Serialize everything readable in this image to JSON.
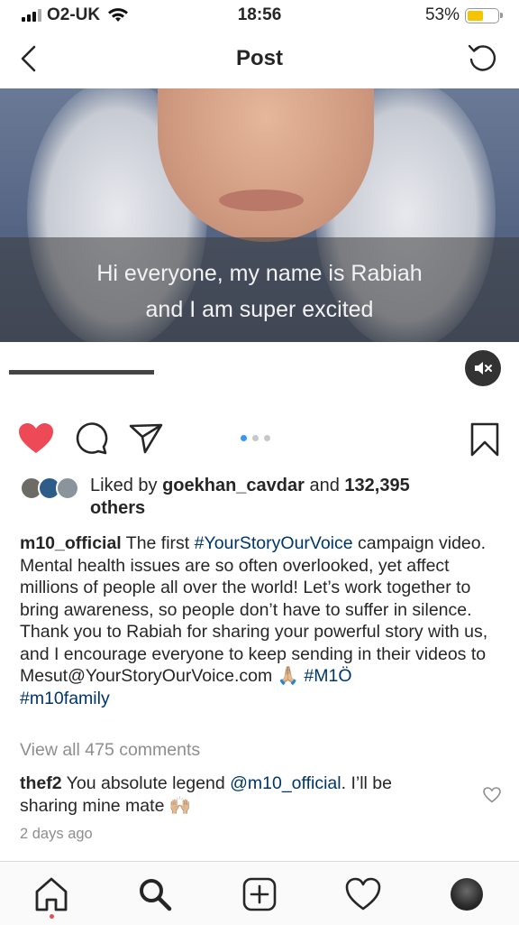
{
  "status_bar": {
    "carrier": "O2-UK",
    "time": "18:56",
    "battery_percent": "53%",
    "battery_level": 0.53
  },
  "nav": {
    "title": "Post"
  },
  "video": {
    "caption_line1": "Hi everyone, my name is Rabiah",
    "caption_line2": "and I am super excited",
    "progress": 0.29,
    "muted": true
  },
  "carousel": {
    "count": 3,
    "active_index": 0
  },
  "likes": {
    "prefix": "Liked by ",
    "user": "goekhan_cavdar",
    "middle": " and ",
    "count": "132,395",
    "suffix": "others"
  },
  "post": {
    "author": "m10_official",
    "text_1": " The first ",
    "hashtag_1": "#YourStoryOurVoice",
    "text_2": " campaign video. Mental health issues are so often overlooked, yet affect millions of people all over the world! Let’s work together to bring awareness, so people don’t have to suffer in silence. Thank you to Rabiah for sharing your powerful story with us, and I encourage everyone to keep sending in their videos to Mesut@YourStoryOurVoice.com ",
    "emoji_1": "🙏🏼",
    "hashtag_2": "#M1Ö",
    "hashtag_3": "#m10family"
  },
  "comments": {
    "view_all": "View all 475 comments",
    "items": [
      {
        "user": "thef2",
        "text_1": " You absolute legend ",
        "mention": "@m10_official",
        "text_2": ". I’ll be sharing mine mate ",
        "emoji": "🙌🏼"
      }
    ]
  },
  "timestamp": "2 days ago",
  "tabs": [
    "home",
    "search",
    "new-post",
    "activity",
    "profile"
  ],
  "colors": {
    "like_red": "#ed4956",
    "link_blue": "#003569",
    "active_dot": "#3897f0",
    "battery_yellow": "#f5c400"
  }
}
